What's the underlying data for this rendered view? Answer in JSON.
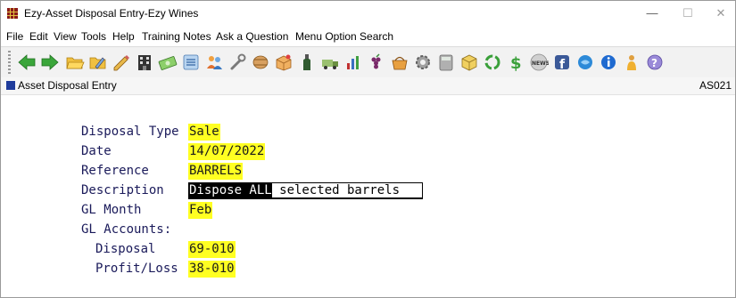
{
  "window": {
    "title": "Ezy-Asset Disposal Entry-Ezy Wines",
    "minimize": "—",
    "maximize": "☐",
    "close": "✕"
  },
  "menu": {
    "items": [
      "File",
      "Edit",
      "View",
      "Tools",
      "Help",
      "Training Notes",
      "Ask a Question",
      "Menu Option Search"
    ]
  },
  "toolbar": {
    "icons": [
      "back-arrow-icon",
      "forward-arrow-icon",
      "open-folder-icon",
      "folder-edit-icon",
      "pencil-icon",
      "building-icon",
      "money-icon",
      "list-icon",
      "people-icon",
      "wrench-icon",
      "barrel-icon",
      "box-icon",
      "bottle-icon",
      "truck-icon",
      "chart-icon",
      "grapes-icon",
      "basket-icon",
      "gear-icon",
      "calculator-icon",
      "cube-icon",
      "recycle-icon",
      "dollar-icon",
      "news-icon",
      "facebook-icon",
      "globe-icon",
      "info-icon",
      "person-icon",
      "help-icon"
    ]
  },
  "form": {
    "header_title": "Asset Disposal Entry",
    "header_code": "AS021",
    "fields": {
      "disposal_type_label": "Disposal Type",
      "disposal_type_value": "Sale",
      "date_label": "Date",
      "date_value": "14/07/2022",
      "reference_label": "Reference",
      "reference_value": "BARRELS",
      "description_label": "Description",
      "description_value_selected": "Dispose ALL",
      "description_value_rest": " selected barrels   ",
      "gl_month_label": "GL Month",
      "gl_month_value": "Feb",
      "gl_accounts_label": "GL Accounts:",
      "disposal_label": "Disposal",
      "disposal_value": "69-010",
      "profit_loss_label": "Profit/Loss",
      "profit_loss_value": "38-010"
    }
  },
  "colors": {
    "field_highlight": "#ffff22",
    "label_text": "#1a1a5a",
    "header_icon": "#1f3c9c"
  }
}
